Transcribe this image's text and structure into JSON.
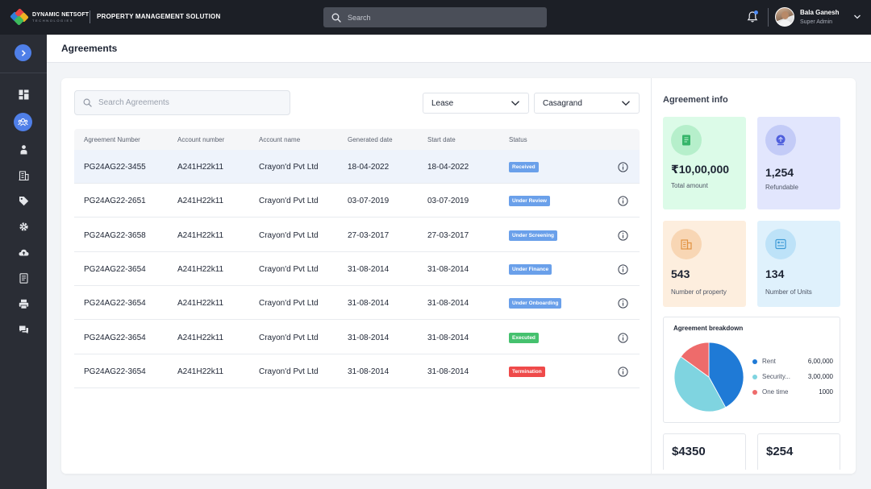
{
  "app": {
    "brand": "DYNAMIC NETSOFT",
    "brand_tagline": "TECHNOLOGIES",
    "title": "PROPERTY MANAGEMENT SOLUTION"
  },
  "header": {
    "search_placeholder": "Search",
    "user_name": "Bala Ganesh",
    "user_role": "Super Admin",
    "notification_icon": "bell-icon"
  },
  "sidebar": {
    "items": [
      {
        "icon": "dashboard-icon"
      },
      {
        "icon": "users-group-icon",
        "active": true
      },
      {
        "icon": "person-icon"
      },
      {
        "icon": "building-icon"
      },
      {
        "icon": "tag-icon"
      },
      {
        "icon": "gear-icon"
      },
      {
        "icon": "cloud-upload-icon"
      },
      {
        "icon": "document-icon"
      },
      {
        "icon": "printer-icon"
      },
      {
        "icon": "chat-icon"
      }
    ]
  },
  "page": {
    "title": "Agreements"
  },
  "list": {
    "search_placeholder": "Search Agreements",
    "filter_type": "Lease",
    "filter_company": "Casagrand",
    "columns": [
      "Agreement Number",
      "Account number",
      "Account name",
      "Generated date",
      "Start date",
      "Status"
    ],
    "rows": [
      {
        "agreement": "PG24AG22-3455",
        "account": "A241H22k11",
        "name": "Crayon'd Pvt Ltd",
        "generated": "18-04-2022",
        "start": "18-04-2022",
        "status": "Received",
        "color": "#6aa0ea"
      },
      {
        "agreement": "PG24AG22-2651",
        "account": "A241H22k11",
        "name": "Crayon'd Pvt Ltd",
        "generated": "03-07-2019",
        "start": "03-07-2019",
        "status": "Under Review",
        "color": "#6aa0ea"
      },
      {
        "agreement": "PG24AG22-3658",
        "account": "A241H22k11",
        "name": "Crayon'd Pvt Ltd",
        "generated": "27-03-2017",
        "start": "27-03-2017",
        "status": "Under Screening",
        "color": "#6aa0ea"
      },
      {
        "agreement": "PG24AG22-3654",
        "account": "A241H22k11",
        "name": "Crayon'd Pvt Ltd",
        "generated": "31-08-2014",
        "start": "31-08-2014",
        "status": "Under Finance",
        "color": "#6aa0ea"
      },
      {
        "agreement": "PG24AG22-3654",
        "account": "A241H22k11",
        "name": "Crayon'd Pvt Ltd",
        "generated": "31-08-2014",
        "start": "31-08-2014",
        "status": "Under Onboarding",
        "color": "#6aa0ea"
      },
      {
        "agreement": "PG24AG22-3654",
        "account": "A241H22k11",
        "name": "Crayon'd Pvt Ltd",
        "generated": "31-08-2014",
        "start": "31-08-2014",
        "status": "Executed",
        "color": "#45c16e"
      },
      {
        "agreement": "PG24AG22-3654",
        "account": "A241H22k11",
        "name": "Crayon'd Pvt Ltd",
        "generated": "31-08-2014",
        "start": "31-08-2014",
        "status": "Termination",
        "color": "#ef4a4a"
      }
    ]
  },
  "info": {
    "title": "Agreement info",
    "stats": [
      {
        "value": "₹10,00,000",
        "label": "Total amount",
        "bg": "#dcfbe8",
        "icon_bg": "#b6efcb",
        "icon_color": "#36b56a",
        "icon": "invoice-icon"
      },
      {
        "value": "1,254",
        "label": "Refundable",
        "bg": "#e2e6fd",
        "icon_bg": "#c3cbf7",
        "icon_color": "#4f5fdc",
        "icon": "refund-icon"
      },
      {
        "value": "543",
        "label": "Number of property",
        "bg": "#fdeede",
        "icon_bg": "#f8d6b4",
        "icon_color": "#e29240",
        "icon": "property-icon"
      },
      {
        "value": "134",
        "label": "Number of Units",
        "bg": "#dff1fc",
        "icon_bg": "#bde2f8",
        "icon_color": "#3c9ad6",
        "icon": "units-icon"
      }
    ],
    "breakdown": {
      "title": "Agreement breakdown",
      "items": [
        {
          "name": "Rent",
          "value": "6,00,000",
          "color": "#1f7ad6"
        },
        {
          "name": "Security...",
          "value": "3,00,000",
          "color": "#7fd4e0"
        },
        {
          "name": "One time",
          "value": "1000",
          "color": "#ee6b6b"
        }
      ],
      "slice_fractions": [
        0.42,
        0.43,
        0.15
      ]
    },
    "mini": [
      "$4350",
      "$254"
    ]
  }
}
